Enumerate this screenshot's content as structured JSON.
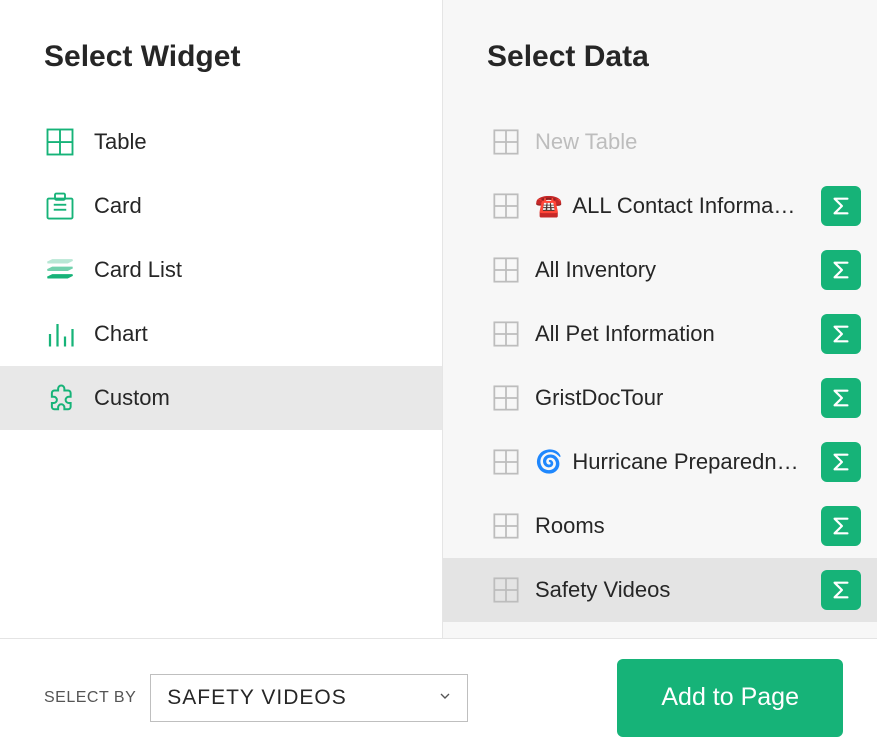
{
  "left": {
    "title": "Select Widget",
    "widgets": [
      {
        "id": "table",
        "label": "Table",
        "icon": "table-icon"
      },
      {
        "id": "card",
        "label": "Card",
        "icon": "card-icon"
      },
      {
        "id": "cardlist",
        "label": "Card List",
        "icon": "cardlist-icon"
      },
      {
        "id": "chart",
        "label": "Chart",
        "icon": "chart-icon"
      },
      {
        "id": "custom",
        "label": "Custom",
        "icon": "custom-icon"
      }
    ],
    "selected": "custom"
  },
  "right": {
    "title": "Select Data",
    "items": [
      {
        "id": "new",
        "label": "New Table",
        "emoji": "",
        "disabled": true,
        "sigma": false
      },
      {
        "id": "contact",
        "label": "ALL Contact Information",
        "emoji": "☎️",
        "disabled": false,
        "sigma": true
      },
      {
        "id": "inventory",
        "label": "All Inventory",
        "emoji": "",
        "disabled": false,
        "sigma": true
      },
      {
        "id": "pet",
        "label": "All Pet Information",
        "emoji": "",
        "disabled": false,
        "sigma": true
      },
      {
        "id": "grist",
        "label": "GristDocTour",
        "emoji": "",
        "disabled": false,
        "sigma": true
      },
      {
        "id": "hurricane",
        "label": "Hurricane Preparedness",
        "emoji": "🌀",
        "disabled": false,
        "sigma": true
      },
      {
        "id": "rooms",
        "label": "Rooms",
        "emoji": "",
        "disabled": false,
        "sigma": true
      },
      {
        "id": "safety",
        "label": "Safety Videos",
        "emoji": "",
        "disabled": false,
        "sigma": true
      }
    ],
    "selected": "safety"
  },
  "footer": {
    "selectByLabel": "SELECT BY",
    "selectByValue": "SAFETY VIDEOS",
    "addButton": "Add to Page"
  },
  "colors": {
    "accent": "#16b378"
  }
}
